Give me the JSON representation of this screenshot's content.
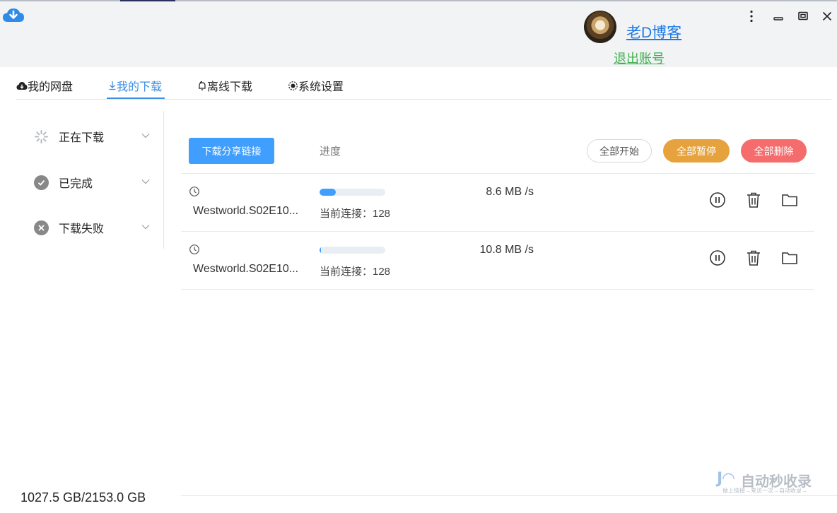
{
  "user": {
    "name": "老D博客",
    "logout": "退出账号"
  },
  "tabs": [
    {
      "label": "我的网盘",
      "icon": "cloud-icon"
    },
    {
      "label": "我的下载",
      "icon": "download-arrow-icon"
    },
    {
      "label": "离线下载",
      "icon": "bell-icon"
    },
    {
      "label": "系统设置",
      "icon": "gear-icon"
    }
  ],
  "active_tab": "我的下载",
  "sidebar": [
    {
      "label": "正在下载",
      "icon": "spinner-icon"
    },
    {
      "label": "已完成",
      "icon": "check-circle-icon"
    },
    {
      "label": "下载失败",
      "icon": "x-circle-icon"
    }
  ],
  "toolbar": {
    "share_link": "下载分享链接",
    "progress_header": "进度",
    "start_all": "全部开始",
    "pause_all": "全部暂停",
    "delete_all": "全部删除"
  },
  "downloads": [
    {
      "filename": "Westworld.S02E10...",
      "progress": 0.25,
      "connections": "当前连接：128",
      "speed": "8.6 MB /s"
    },
    {
      "filename": "Westworld.S02E10...",
      "progress": 0.02,
      "connections": "当前连接：128",
      "speed": "10.8 MB /s"
    }
  ],
  "storage": "1027.5 GB/2153.0 GB",
  "watermark": {
    "mark": "J◠",
    "title": "自动秒收录",
    "subtitle": "做上链接→来访一次→自动收录→"
  },
  "colors": {
    "primary": "#409eff",
    "pause": "#e6a23c",
    "delete": "#f56c6c",
    "logout": "#3fb14e",
    "username": "#1e7ae6"
  }
}
